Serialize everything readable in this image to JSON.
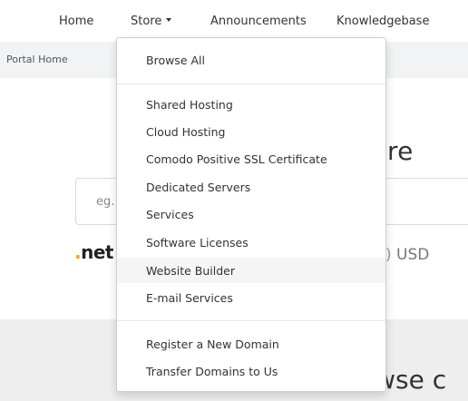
{
  "nav": {
    "home": "Home",
    "store": "Store",
    "announcements": "Announcements",
    "knowledgebase": "Knowledgebase"
  },
  "breadcrumb": {
    "portal_home": "Portal Home"
  },
  "page": {
    "hero_partial": "ecure",
    "search_placeholder_partial": "eg.",
    "tld_name": "net",
    "tld_price_partial": "USD",
    "browse_partial": "owse c"
  },
  "dropdown": {
    "browse_all": "Browse All",
    "categories": [
      "Shared Hosting",
      "Cloud Hosting",
      "Comodo Positive SSL Certificate",
      "Dedicated Servers",
      "Services",
      "Software Licenses",
      "Website Builder",
      "E-mail Services"
    ],
    "domain_links": [
      "Register a New Domain",
      "Transfer Domains to Us"
    ]
  },
  "colors": {
    "accent_dot": "#f0a22b",
    "crumb_bar": "#f2f3f5",
    "hover_item": "#f5f5f5"
  }
}
